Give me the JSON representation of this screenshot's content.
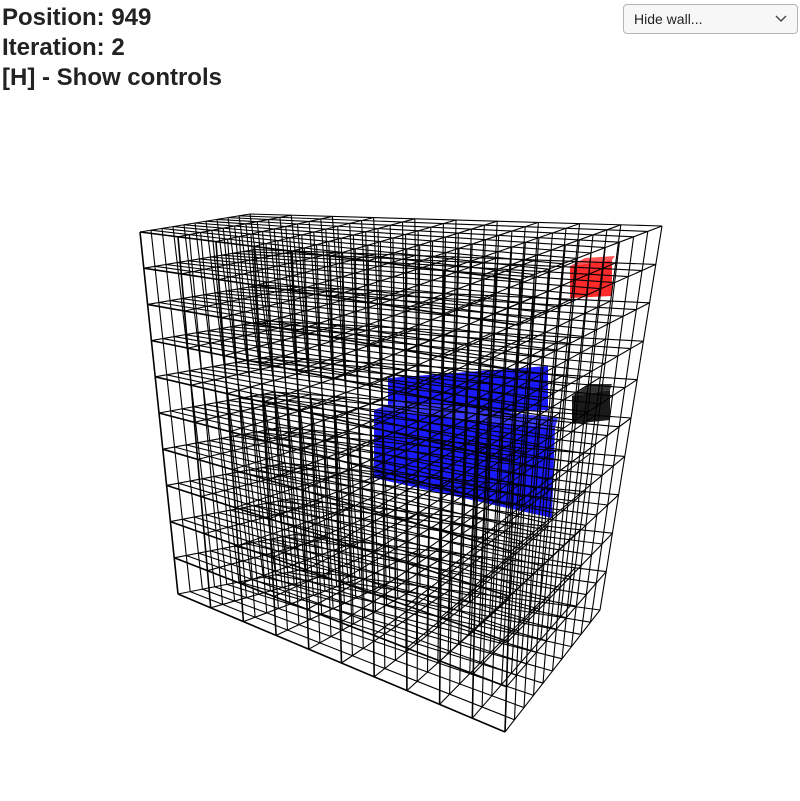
{
  "hud": {
    "position_label": "Position: 949",
    "iteration_label": "Iteration: 2",
    "controls_hint": "[H] - Show controls"
  },
  "wall_select": {
    "selected": "Hide wall...",
    "icon": "chevron-down-icon"
  },
  "scene": {
    "grid_size": 10,
    "colors": {
      "grid_line": "#000000",
      "background": "#ffffff",
      "highlight_red": "#ff2a2a",
      "highlight_blue": "#1a1aff",
      "cursor_black": "#1a1a1a"
    }
  }
}
